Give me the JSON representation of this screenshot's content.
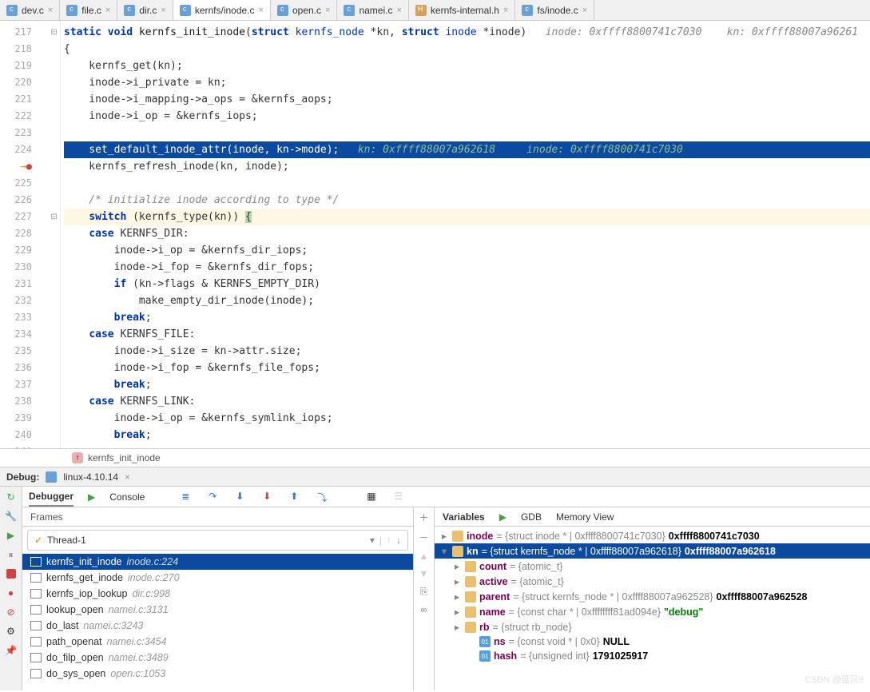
{
  "tabs": [
    {
      "label": "dev.c",
      "icon": "c"
    },
    {
      "label": "file.c",
      "icon": "c"
    },
    {
      "label": "dir.c",
      "icon": "c"
    },
    {
      "label": "kernfs/inode.c",
      "icon": "c",
      "active": true
    },
    {
      "label": "open.c",
      "icon": "c"
    },
    {
      "label": "namei.c",
      "icon": "c"
    },
    {
      "label": "kernfs-internal.h",
      "icon": "h"
    },
    {
      "label": "fs/inode.c",
      "icon": "c"
    }
  ],
  "lines": {
    "start": 217,
    "end": 241,
    "breakpoint": 224,
    "current": 228
  },
  "code": {
    "l217_kw1": "static",
    "l217_kw2": "void",
    "l217_fn": "kernfs_init_inode",
    "l217_kw3": "struct",
    "l217_ty1": "kernfs_node",
    "l217_p1": "*kn,",
    "l217_kw4": "struct",
    "l217_ty2": "inode",
    "l217_p2": "*inode)",
    "l217_cm": "inode: 0xffff8800741c7030    kn: 0xffff88007a96261",
    "l218": "{",
    "l219": "    kernfs_get(kn);",
    "l220": "    inode->i_private = kn;",
    "l221": "    inode->i_mapping->a_ops = &kernfs_aops;",
    "l222": "    inode->i_op = &kernfs_iops;",
    "l224": "    set_default_inode_attr(inode, kn->mode);",
    "l224_cm": "   kn: 0xffff88007a962618     inode: 0xffff8800741c7030",
    "l225": "    kernfs_refresh_inode(kn, inode);",
    "l227": "    /* initialize inode according to type */",
    "l228a": "    ",
    "l228_kw": "switch",
    "l228b": " (kernfs_type(kn)) ",
    "l228c": "{",
    "l229a": "    ",
    "l229_kw": "case",
    "l229b": " KERNFS_DIR:",
    "l230": "        inode->i_op = &kernfs_dir_iops;",
    "l231": "        inode->i_fop = &kernfs_dir_fops;",
    "l232a": "        ",
    "l232_kw": "if",
    "l232b": " (kn->flags & KERNFS_EMPTY_DIR)",
    "l233": "            make_empty_dir_inode(inode);",
    "l234a": "        ",
    "l234_kw": "break",
    "l234b": ";",
    "l235a": "    ",
    "l235_kw": "case",
    "l235b": " KERNFS_FILE:",
    "l236": "        inode->i_size = kn->attr.size;",
    "l237": "        inode->i_fop = &kernfs_file_fops;",
    "l238a": "        ",
    "l238_kw": "break",
    "l238b": ";",
    "l239a": "    ",
    "l239_kw": "case",
    "l239b": " KERNFS_LINK:",
    "l240": "        inode->i_op = &kernfs_symlink_iops;",
    "l241a": "        ",
    "l241_kw": "break",
    "l241b": ";"
  },
  "breadcrumb": {
    "icon": "f",
    "fn": "kernfs_init_inode"
  },
  "debug": {
    "title": "Debug:",
    "project": "linux-4.10.14",
    "tabs": {
      "debugger": "Debugger",
      "console": "Console"
    },
    "thread": "Thread-1",
    "frames_hdr": "Frames",
    "frames": [
      {
        "fn": "kernfs_init_inode",
        "loc": "inode.c:224",
        "sel": true
      },
      {
        "fn": "kernfs_get_inode",
        "loc": "inode.c:270"
      },
      {
        "fn": "kernfs_iop_lookup",
        "loc": "dir.c:998"
      },
      {
        "fn": "lookup_open",
        "loc": "namei.c:3131"
      },
      {
        "fn": "do_last",
        "loc": "namei.c:3243"
      },
      {
        "fn": "path_openat",
        "loc": "namei.c:3454"
      },
      {
        "fn": "do_filp_open",
        "loc": "namei.c:3489"
      },
      {
        "fn": "do_sys_open",
        "loc": "open.c:1053"
      }
    ],
    "vars_tabs": {
      "variables": "Variables",
      "gdb": "GDB",
      "memory": "Memory View"
    },
    "vars": [
      {
        "d": 0,
        "exp": "▸",
        "ico": "s",
        "nm": "inode",
        "ty": " = {struct inode * | 0xffff8800741c7030} ",
        "val": "0xffff8800741c7030"
      },
      {
        "d": 0,
        "exp": "▾",
        "ico": "s",
        "nm": "kn",
        "ty": " = {struct kernfs_node * | 0xffff88007a962618} ",
        "val": "0xffff88007a962618",
        "sel": true
      },
      {
        "d": 1,
        "exp": "▸",
        "ico": "s",
        "nm": "count",
        "ty": " = {atomic_t}",
        "val": ""
      },
      {
        "d": 1,
        "exp": "▸",
        "ico": "s",
        "nm": "active",
        "ty": " = {atomic_t}",
        "val": ""
      },
      {
        "d": 1,
        "exp": "▸",
        "ico": "s",
        "nm": "parent",
        "ty": " = {struct kernfs_node * | 0xffff88007a962528} ",
        "val": "0xffff88007a962528"
      },
      {
        "d": 1,
        "exp": "▸",
        "ico": "s",
        "nm": "name",
        "ty": " = {const char * | 0xffffffff81ad094e} ",
        "str": "\"debug\""
      },
      {
        "d": 1,
        "exp": "▸",
        "ico": "s",
        "nm": "rb",
        "ty": " = {struct rb_node}",
        "val": ""
      },
      {
        "d": 2,
        "exp": " ",
        "ico": "n",
        "ictxt": "01",
        "nm": "ns",
        "ty": " = {const void * | 0x0} ",
        "val": "NULL"
      },
      {
        "d": 2,
        "exp": " ",
        "ico": "n",
        "ictxt": "01",
        "nm": "hash",
        "ty": " = {unsigned int} ",
        "val": "1791025917"
      }
    ]
  },
  "watermark": "CSDN @蓝风9"
}
